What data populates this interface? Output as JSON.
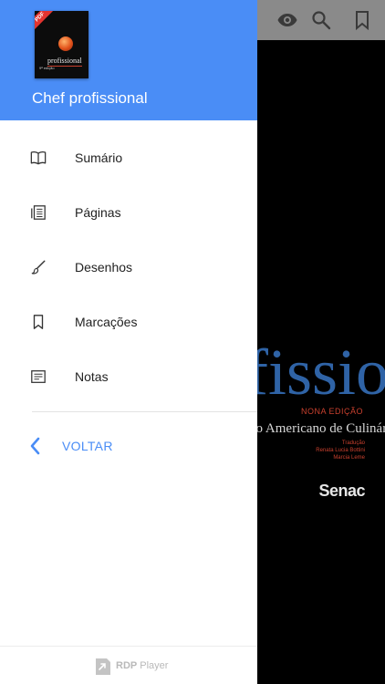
{
  "drawer": {
    "book_title": "Chef profissional",
    "cover": {
      "badge": "PDF",
      "title": "profissional",
      "edition": "9ª edição"
    },
    "menu": [
      {
        "label": "Sumário",
        "icon": "book-open-icon"
      },
      {
        "label": "Páginas",
        "icon": "pages-icon"
      },
      {
        "label": "Desenhos",
        "icon": "brush-icon"
      },
      {
        "label": "Marcações",
        "icon": "bookmark-icon"
      },
      {
        "label": "Notas",
        "icon": "notes-icon"
      }
    ],
    "back_label": "VOLTAR",
    "footer": {
      "brand_bold": "RDP",
      "brand_light": "Player"
    }
  },
  "reader": {
    "toolbar_icons": [
      "eye-icon",
      "search-icon",
      "bookmark-icon"
    ],
    "page": {
      "title_fragment": "profissional",
      "edition": "NONA EDIÇÃO",
      "subtitle": "Instituto Americano de Culinária",
      "credits": [
        "Tradução",
        "Renata Lucia Bottini",
        "Marcia Leme"
      ],
      "publisher": "Senac"
    }
  },
  "colors": {
    "accent": "#4a8df6",
    "drawer_bg": "#ffffff",
    "reader_bg": "#000000",
    "toolbar_bg": "#8a8a8a",
    "page_title": "#2f63a6",
    "page_red": "#c9402e"
  }
}
